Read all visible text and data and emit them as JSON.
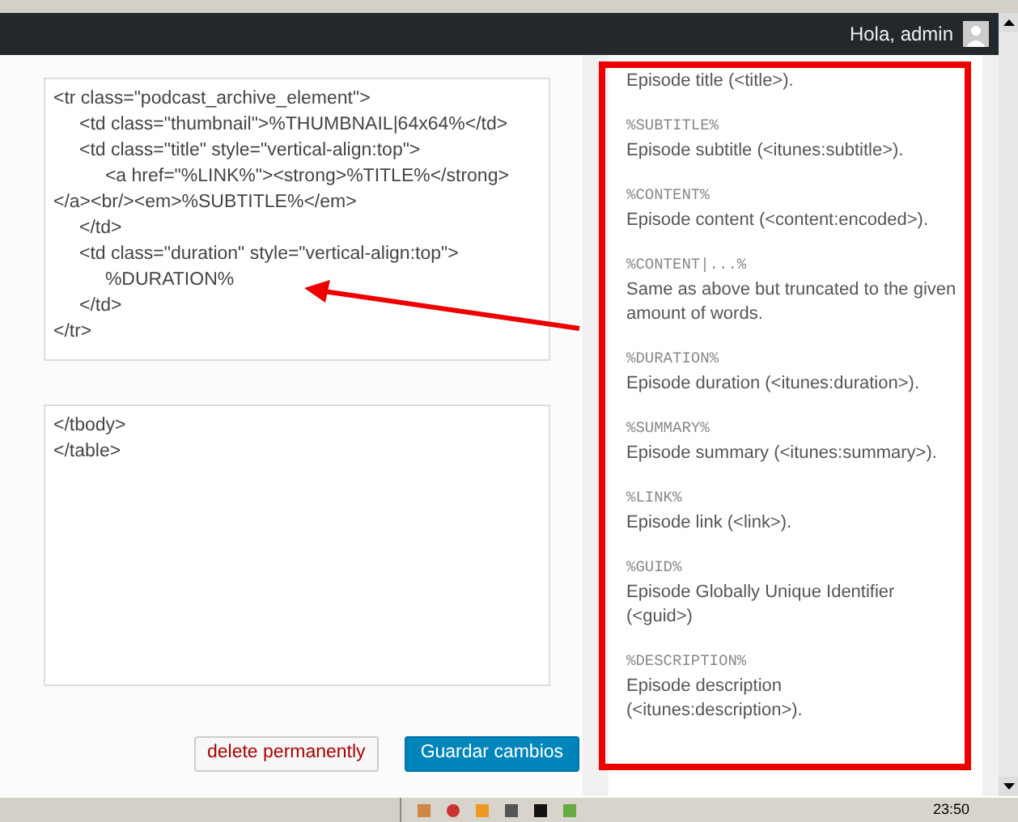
{
  "admin_bar": {
    "greeting": "Hola, admin"
  },
  "editor": {
    "item_template": "<tr class=\"podcast_archive_element\">\n\t<td class=\"thumbnail\">%THUMBNAIL|64x64%</td>\n\t<td class=\"title\" style=\"vertical-align:top\">\n\t\t<a href=\"%LINK%\"><strong>%TITLE%</strong>\n</a><br/><em>%SUBTITLE%</em>\n\t</td>\n\t<td class=\"duration\" style=\"vertical-align:top\">\n\t\t%DURATION%\n\t</td>\n</tr>",
    "after_template": "</tbody>\n</table>"
  },
  "buttons": [
    {
      "kind": "delete",
      "label": "delete permanently"
    },
    {
      "kind": "primary",
      "label": "Guardar cambios"
    }
  ],
  "placeholders": [
    {
      "description": "Episode title (<title>)."
    },
    {
      "code": "%SUBTITLE%",
      "description": "Episode subtitle (<itunes:subtitle>)."
    },
    {
      "code": "%CONTENT%",
      "description": "Episode content (<content:encoded>)."
    },
    {
      "code": "%CONTENT|...%",
      "description": "Same as above but truncated to the given amount of words."
    },
    {
      "code": "%DURATION%",
      "description": "Episode duration (<itunes:duration>)."
    },
    {
      "code": "%SUMMARY%",
      "description": "Episode summary (<itunes:summary>)."
    },
    {
      "code": "%LINK%",
      "description": "Episode link (<link>)."
    },
    {
      "code": "%GUID%",
      "description": "Episode Globally Unique Identifier (<guid>)"
    },
    {
      "code": "%DESCRIPTION%",
      "description": "Episode description (<itunes:description>)."
    }
  ],
  "taskbar": {
    "clock": "23:50"
  }
}
